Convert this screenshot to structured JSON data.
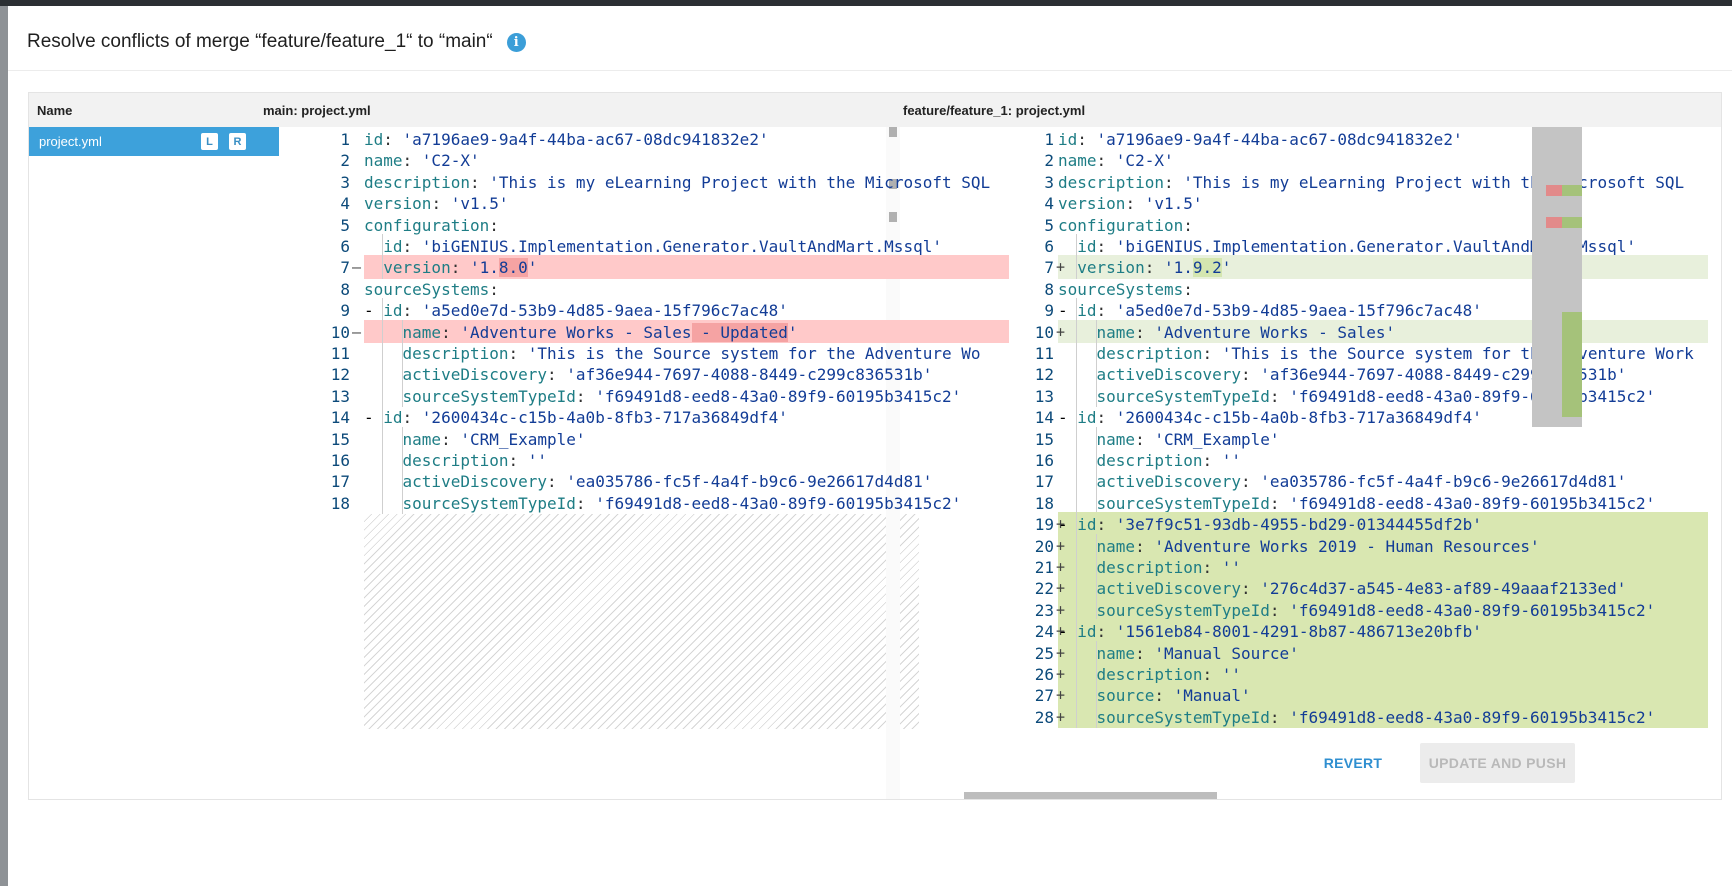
{
  "dialog": {
    "title": "Resolve conflicts of merge “feature/feature_1“ to “main“",
    "info_icon": "info-icon"
  },
  "columns": {
    "name": "Name",
    "left_file": "main: project.yml",
    "right_file": "feature/feature_1: project.yml"
  },
  "files": [
    {
      "name": "project.yml",
      "badge_left": "L",
      "badge_right": "R"
    }
  ],
  "left_lines": [
    {
      "n": "1",
      "marker": "",
      "key": "id",
      "value": "'a7196ae9-9a4f-44ba-ac67-08dc941832e2'"
    },
    {
      "n": "2",
      "marker": "",
      "key": "name",
      "value": "'C2-X'"
    },
    {
      "n": "3",
      "marker": "",
      "key": "description",
      "value": "'This is my eLearning Project with the Microsoft SQL"
    },
    {
      "n": "4",
      "marker": "",
      "key": "version",
      "value": "'v1.5'"
    },
    {
      "n": "5",
      "marker": "",
      "key": "configuration",
      "value": ""
    },
    {
      "n": "6",
      "marker": "",
      "key": "id",
      "value": "'biGENIUS.Implementation.Generator.VaultAndMart.Mssql'"
    },
    {
      "n": "7",
      "marker": "—",
      "key": "version",
      "value_pre": "'1.",
      "value_hl": "8.0",
      "value_post": "'"
    },
    {
      "n": "8",
      "marker": "",
      "key": "sourceSystems",
      "value": ""
    },
    {
      "n": "9",
      "marker": "",
      "key": "id",
      "value": "'a5ed0e7d-53b9-4d85-9aea-15f796c7ac48'"
    },
    {
      "n": "10",
      "marker": "—",
      "key": "name",
      "value_pre": "'Adventure Works - Sales",
      "value_hl": " - Updated",
      "value_post": "'"
    },
    {
      "n": "11",
      "marker": "",
      "key": "description",
      "value": "'This is the Source system for the Adventure Wo"
    },
    {
      "n": "12",
      "marker": "",
      "key": "activeDiscovery",
      "value": "'af36e944-7697-4088-8449-c299c836531b'"
    },
    {
      "n": "13",
      "marker": "",
      "key": "sourceSystemTypeId",
      "value": "'f69491d8-eed8-43a0-89f9-60195b3415c2'"
    },
    {
      "n": "14",
      "marker": "",
      "key": "id",
      "value": "'2600434c-c15b-4a0b-8fb3-717a36849df4'"
    },
    {
      "n": "15",
      "marker": "",
      "key": "name",
      "value": "'CRM_Example'"
    },
    {
      "n": "16",
      "marker": "",
      "key": "description",
      "value": "''"
    },
    {
      "n": "17",
      "marker": "",
      "key": "activeDiscovery",
      "value": "'ea035786-fc5f-4a4f-b9c6-9e26617d4d81'"
    },
    {
      "n": "18",
      "marker": "",
      "key": "sourceSystemTypeId",
      "value": "'f69491d8-eed8-43a0-89f9-60195b3415c2'"
    }
  ],
  "right_lines": [
    {
      "n": "1",
      "marker": "",
      "key": "id",
      "value": "'a7196ae9-9a4f-44ba-ac67-08dc941832e2'"
    },
    {
      "n": "2",
      "marker": "",
      "key": "name",
      "value": "'C2-X'"
    },
    {
      "n": "3",
      "marker": "",
      "key": "description",
      "value": "'This is my eLearning Project with the Microsoft SQL"
    },
    {
      "n": "4",
      "marker": "",
      "key": "version",
      "value": "'v1.5'"
    },
    {
      "n": "5",
      "marker": "",
      "key": "configuration",
      "value": ""
    },
    {
      "n": "6",
      "marker": "",
      "key": "id",
      "value": "'biGENIUS.Implementation.Generator.VaultAndMart.Mssql'"
    },
    {
      "n": "7",
      "marker": "+",
      "key": "version",
      "value_pre": "'1.",
      "value_hl": "9.2",
      "value_post": "'"
    },
    {
      "n": "8",
      "marker": "",
      "key": "sourceSystems",
      "value": ""
    },
    {
      "n": "9",
      "marker": "",
      "key": "id",
      "value": "'a5ed0e7d-53b9-4d85-9aea-15f796c7ac48'"
    },
    {
      "n": "10",
      "marker": "+",
      "key": "name",
      "value": "'Adventure Works - Sales'"
    },
    {
      "n": "11",
      "marker": "",
      "key": "description",
      "value": "'This is the Source system for the Adventure Work"
    },
    {
      "n": "12",
      "marker": "",
      "key": "activeDiscovery",
      "value": "'af36e944-7697-4088-8449-c299c836531b'"
    },
    {
      "n": "13",
      "marker": "",
      "key": "sourceSystemTypeId",
      "value": "'f69491d8-eed8-43a0-89f9-60195b3415c2'"
    },
    {
      "n": "14",
      "marker": "",
      "key": "id",
      "value": "'2600434c-c15b-4a0b-8fb3-717a36849df4'"
    },
    {
      "n": "15",
      "marker": "",
      "key": "name",
      "value": "'CRM_Example'"
    },
    {
      "n": "16",
      "marker": "",
      "key": "description",
      "value": "''"
    },
    {
      "n": "17",
      "marker": "",
      "key": "activeDiscovery",
      "value": "'ea035786-fc5f-4a4f-b9c6-9e26617d4d81'"
    },
    {
      "n": "18",
      "marker": "",
      "key": "sourceSystemTypeId",
      "value": "'f69491d8-eed8-43a0-89f9-60195b3415c2'"
    },
    {
      "n": "19",
      "marker": "+",
      "key": "id",
      "value": "'3e7f9c51-93db-4955-bd29-01344455df2b'"
    },
    {
      "n": "20",
      "marker": "+",
      "key": "name",
      "value": "'Adventure Works 2019 - Human Resources'"
    },
    {
      "n": "21",
      "marker": "+",
      "key": "description",
      "value": "''"
    },
    {
      "n": "22",
      "marker": "+",
      "key": "activeDiscovery",
      "value": "'276c4d37-a545-4e83-af89-49aaaf2133ed'"
    },
    {
      "n": "23",
      "marker": "+",
      "key": "sourceSystemTypeId",
      "value": "'f69491d8-eed8-43a0-89f9-60195b3415c2'"
    },
    {
      "n": "24",
      "marker": "+",
      "key": "id",
      "value": "'1561eb84-8001-4291-8b87-486713e20bfb'"
    },
    {
      "n": "25",
      "marker": "+",
      "key": "name",
      "value": "'Manual_Source'"
    },
    {
      "n": "26",
      "marker": "+",
      "key": "description",
      "value": "''"
    },
    {
      "n": "27",
      "marker": "+",
      "key": "source",
      "value": "'Manual'"
    },
    {
      "n": "28",
      "marker": "+",
      "key": "sourceSystemTypeId",
      "value": "'f69491d8-eed8-43a0-89f9-60195b3415c2'"
    }
  ],
  "buttons": {
    "revert": "REVERT",
    "update_and_push": "UPDATE AND PUSH"
  },
  "colors": {
    "accent": "#3da1db",
    "deleted_line": "#ffc9c9",
    "deleted_highlight": "#f5a3a3",
    "added_line": "#d9e7b1",
    "modified_line": "#e8f0dc"
  }
}
